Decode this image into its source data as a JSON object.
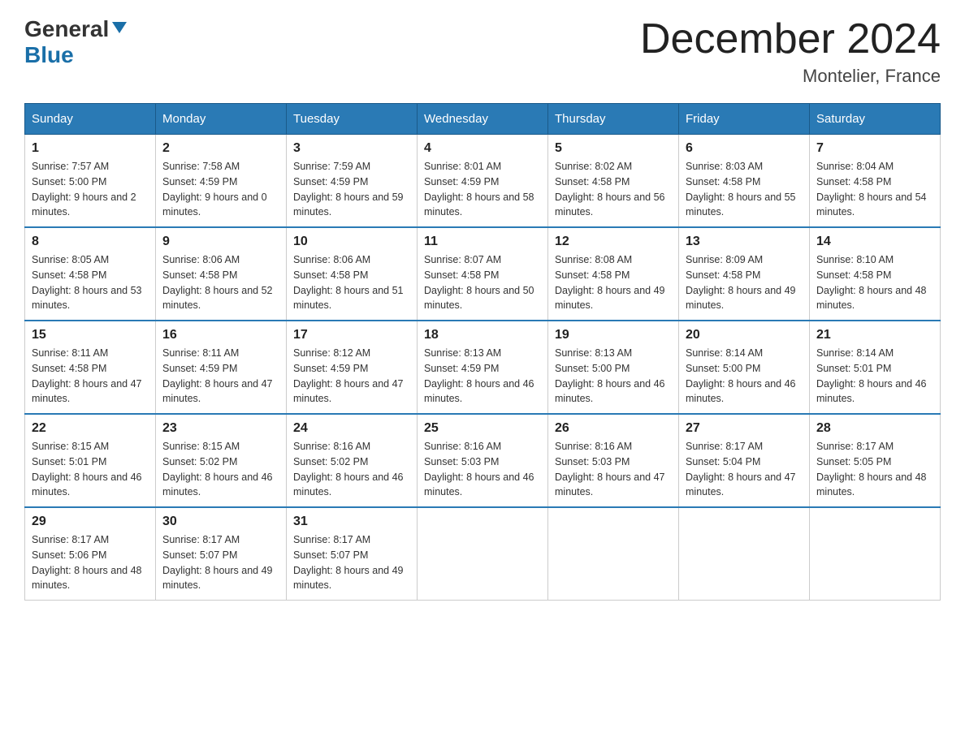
{
  "logo": {
    "general": "General",
    "blue": "Blue"
  },
  "title": {
    "month_year": "December 2024",
    "location": "Montelier, France"
  },
  "weekdays": [
    "Sunday",
    "Monday",
    "Tuesday",
    "Wednesday",
    "Thursday",
    "Friday",
    "Saturday"
  ],
  "weeks": [
    [
      {
        "day": "1",
        "sunrise": "7:57 AM",
        "sunset": "5:00 PM",
        "daylight": "9 hours and 2 minutes."
      },
      {
        "day": "2",
        "sunrise": "7:58 AM",
        "sunset": "4:59 PM",
        "daylight": "9 hours and 0 minutes."
      },
      {
        "day": "3",
        "sunrise": "7:59 AM",
        "sunset": "4:59 PM",
        "daylight": "8 hours and 59 minutes."
      },
      {
        "day": "4",
        "sunrise": "8:01 AM",
        "sunset": "4:59 PM",
        "daylight": "8 hours and 58 minutes."
      },
      {
        "day": "5",
        "sunrise": "8:02 AM",
        "sunset": "4:58 PM",
        "daylight": "8 hours and 56 minutes."
      },
      {
        "day": "6",
        "sunrise": "8:03 AM",
        "sunset": "4:58 PM",
        "daylight": "8 hours and 55 minutes."
      },
      {
        "day": "7",
        "sunrise": "8:04 AM",
        "sunset": "4:58 PM",
        "daylight": "8 hours and 54 minutes."
      }
    ],
    [
      {
        "day": "8",
        "sunrise": "8:05 AM",
        "sunset": "4:58 PM",
        "daylight": "8 hours and 53 minutes."
      },
      {
        "day": "9",
        "sunrise": "8:06 AM",
        "sunset": "4:58 PM",
        "daylight": "8 hours and 52 minutes."
      },
      {
        "day": "10",
        "sunrise": "8:06 AM",
        "sunset": "4:58 PM",
        "daylight": "8 hours and 51 minutes."
      },
      {
        "day": "11",
        "sunrise": "8:07 AM",
        "sunset": "4:58 PM",
        "daylight": "8 hours and 50 minutes."
      },
      {
        "day": "12",
        "sunrise": "8:08 AM",
        "sunset": "4:58 PM",
        "daylight": "8 hours and 49 minutes."
      },
      {
        "day": "13",
        "sunrise": "8:09 AM",
        "sunset": "4:58 PM",
        "daylight": "8 hours and 49 minutes."
      },
      {
        "day": "14",
        "sunrise": "8:10 AM",
        "sunset": "4:58 PM",
        "daylight": "8 hours and 48 minutes."
      }
    ],
    [
      {
        "day": "15",
        "sunrise": "8:11 AM",
        "sunset": "4:58 PM",
        "daylight": "8 hours and 47 minutes."
      },
      {
        "day": "16",
        "sunrise": "8:11 AM",
        "sunset": "4:59 PM",
        "daylight": "8 hours and 47 minutes."
      },
      {
        "day": "17",
        "sunrise": "8:12 AM",
        "sunset": "4:59 PM",
        "daylight": "8 hours and 47 minutes."
      },
      {
        "day": "18",
        "sunrise": "8:13 AM",
        "sunset": "4:59 PM",
        "daylight": "8 hours and 46 minutes."
      },
      {
        "day": "19",
        "sunrise": "8:13 AM",
        "sunset": "5:00 PM",
        "daylight": "8 hours and 46 minutes."
      },
      {
        "day": "20",
        "sunrise": "8:14 AM",
        "sunset": "5:00 PM",
        "daylight": "8 hours and 46 minutes."
      },
      {
        "day": "21",
        "sunrise": "8:14 AM",
        "sunset": "5:01 PM",
        "daylight": "8 hours and 46 minutes."
      }
    ],
    [
      {
        "day": "22",
        "sunrise": "8:15 AM",
        "sunset": "5:01 PM",
        "daylight": "8 hours and 46 minutes."
      },
      {
        "day": "23",
        "sunrise": "8:15 AM",
        "sunset": "5:02 PM",
        "daylight": "8 hours and 46 minutes."
      },
      {
        "day": "24",
        "sunrise": "8:16 AM",
        "sunset": "5:02 PM",
        "daylight": "8 hours and 46 minutes."
      },
      {
        "day": "25",
        "sunrise": "8:16 AM",
        "sunset": "5:03 PM",
        "daylight": "8 hours and 46 minutes."
      },
      {
        "day": "26",
        "sunrise": "8:16 AM",
        "sunset": "5:03 PM",
        "daylight": "8 hours and 47 minutes."
      },
      {
        "day": "27",
        "sunrise": "8:17 AM",
        "sunset": "5:04 PM",
        "daylight": "8 hours and 47 minutes."
      },
      {
        "day": "28",
        "sunrise": "8:17 AM",
        "sunset": "5:05 PM",
        "daylight": "8 hours and 48 minutes."
      }
    ],
    [
      {
        "day": "29",
        "sunrise": "8:17 AM",
        "sunset": "5:06 PM",
        "daylight": "8 hours and 48 minutes."
      },
      {
        "day": "30",
        "sunrise": "8:17 AM",
        "sunset": "5:07 PM",
        "daylight": "8 hours and 49 minutes."
      },
      {
        "day": "31",
        "sunrise": "8:17 AM",
        "sunset": "5:07 PM",
        "daylight": "8 hours and 49 minutes."
      },
      null,
      null,
      null,
      null
    ]
  ],
  "labels": {
    "sunrise": "Sunrise:",
    "sunset": "Sunset:",
    "daylight": "Daylight:"
  }
}
